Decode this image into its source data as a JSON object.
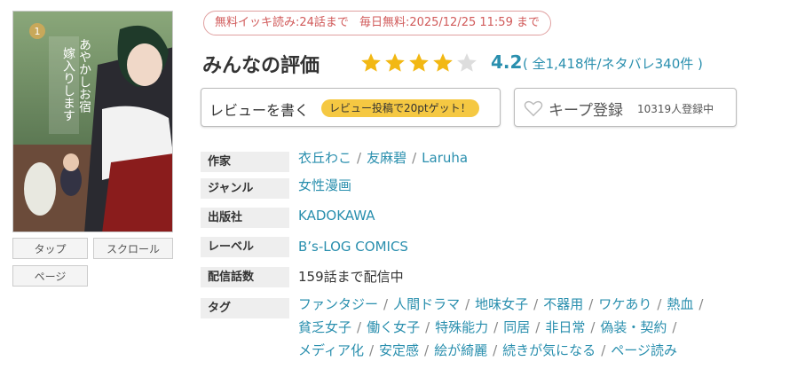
{
  "colors": {
    "accent": "#2a8fae",
    "star": "#f2b814",
    "star_empty": "#dddddd",
    "banner": "#d15a5a",
    "badge": "#f5c842"
  },
  "cover": {
    "alt_icon": "manga-cover-image",
    "volume_badge": "1"
  },
  "view_buttons": [
    "タップ",
    "スクロール",
    "ページ"
  ],
  "banner": {
    "free_bulk": "無料イッキ読み:24話まで",
    "daily_free": "毎日無料:2025/12/25 11:59 まで"
  },
  "rating": {
    "title": "みんなの評価",
    "score": "4.2",
    "stars_value": 4.2,
    "stars_max": 5,
    "counts": "( 全1,418件/ネタバレ340件 )"
  },
  "review_button": {
    "label": "レビューを書く",
    "badge": "レビュー投稿で20ptゲット！"
  },
  "keep_button": {
    "icon": "heart-icon",
    "label": "キープ登録",
    "count": "10319人登録中"
  },
  "info": {
    "author_label": "作家",
    "authors": [
      "衣丘わこ",
      "友麻碧",
      "Laruha"
    ],
    "genre_label": "ジャンル",
    "genre": "女性漫画",
    "publisher_label": "出版社",
    "publisher": "KADOKAWA",
    "label_label": "レーベル",
    "label": "B’s-LOG COMICS",
    "episodes_label": "配信話数",
    "episodes": "159話まで配信中",
    "tags_label": "タグ",
    "tags": [
      [
        "ファンタジー",
        "人間ドラマ",
        "地味女子",
        "不器用",
        "ワケあり",
        "熱血"
      ],
      [
        "貧乏女子",
        "働く女子",
        "特殊能力",
        "同居",
        "非日常",
        "偽装・契約"
      ],
      [
        "メディア化",
        "安定感",
        "絵が綺麗",
        "続きが気になる",
        "ページ読み"
      ]
    ]
  }
}
